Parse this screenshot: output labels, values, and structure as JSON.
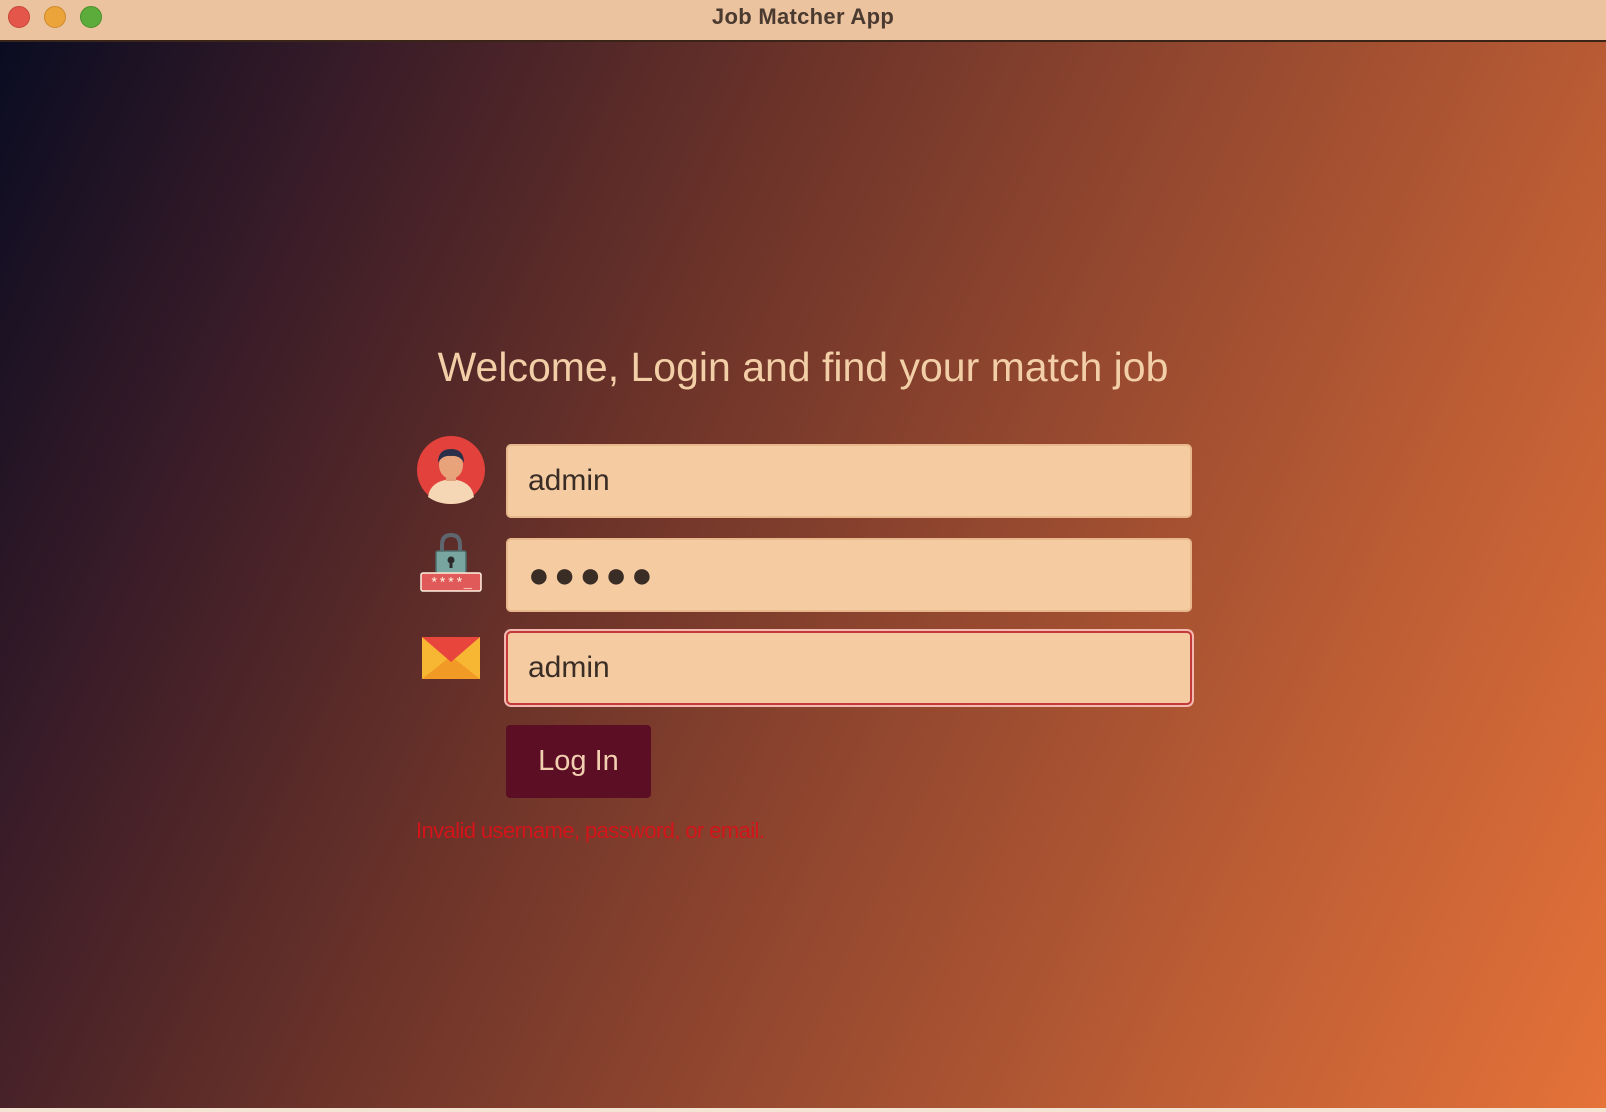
{
  "window": {
    "title": "Job Matcher App"
  },
  "login": {
    "heading": "Welcome, Login and find your match job",
    "username_value": "admin",
    "password_masked": "●●●●●",
    "email_value": "admin",
    "login_label": "Log In",
    "error_message": "Invalid username, password, or email."
  },
  "icons": {
    "user": "user-avatar-icon",
    "password": "padlock-password-icon",
    "email": "envelope-icon"
  },
  "colors": {
    "field_background": "#f5cba1",
    "button_background": "#5c0e24",
    "error_text": "#d4141a",
    "heading_text": "#f3cfa8"
  }
}
